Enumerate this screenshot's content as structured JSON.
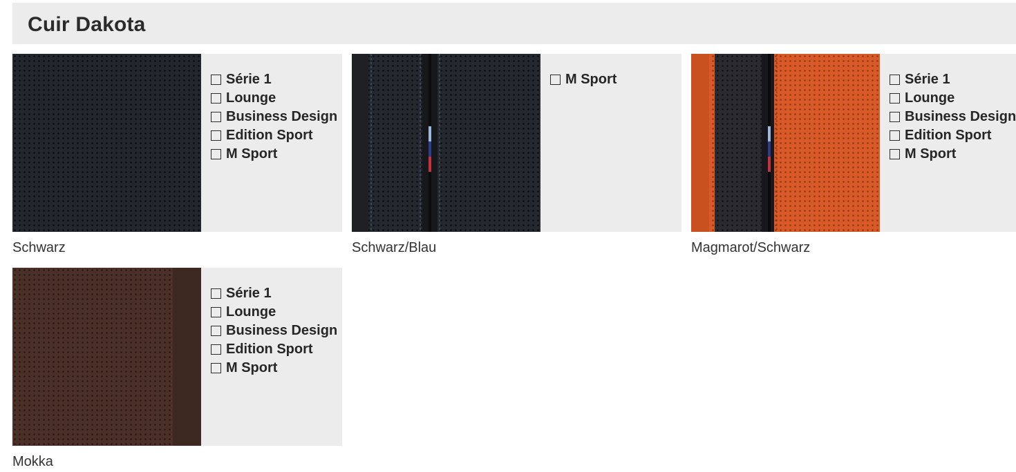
{
  "header": {
    "title": "Cuir Dakota"
  },
  "swatches": [
    {
      "caption": "Schwarz",
      "options": [
        "Série 1",
        "Lounge",
        "Business Design",
        "Edition Sport",
        "M Sport"
      ],
      "colors": {
        "base": "#23262d",
        "dot": "#0d0f13"
      }
    },
    {
      "caption": "Schwarz/Blau",
      "options": [
        "M Sport"
      ],
      "colors": {
        "base": "#25282f",
        "dot": "#0e1014",
        "stitch": "#55627a"
      }
    },
    {
      "caption": "Magmarot/Schwarz",
      "options": [
        "Série 1",
        "Lounge",
        "Business Design",
        "Edition Sport",
        "M Sport"
      ],
      "colors": {
        "base": "#d75a28",
        "dot": "#9e3a14",
        "dark": "#2a2a30"
      }
    },
    {
      "caption": "Mokka",
      "options": [
        "Série 1",
        "Lounge",
        "Business Design",
        "Edition Sport",
        "M Sport"
      ],
      "colors": {
        "base": "#4a3028",
        "dot": "#2c1b16"
      }
    }
  ]
}
